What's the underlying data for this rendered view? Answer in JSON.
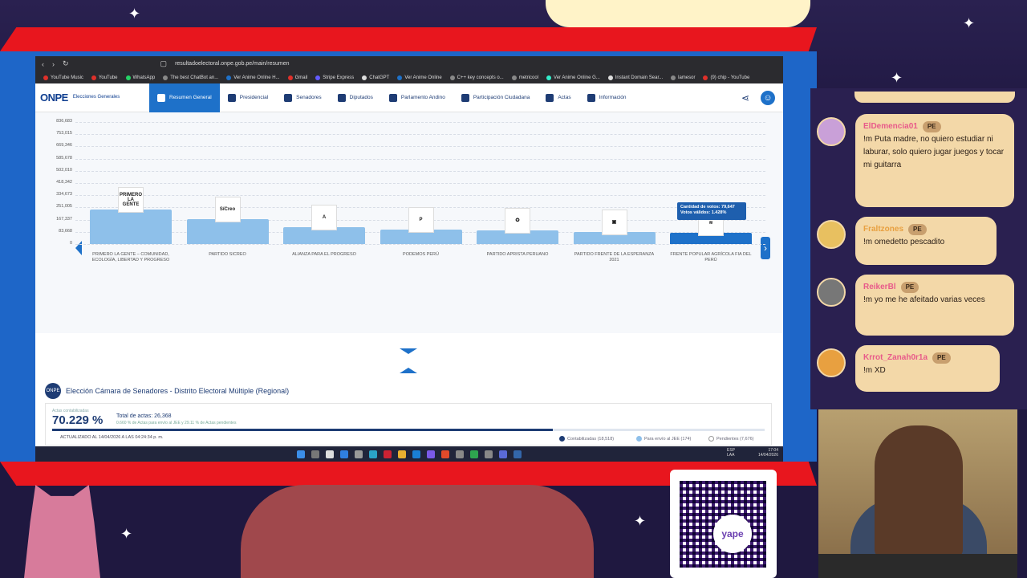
{
  "browser": {
    "url": "resultadoelectoral.onpe.gob.pe/main/resumen",
    "bookmarks": [
      {
        "label": "YouTube Music",
        "color": "#e0302a"
      },
      {
        "label": "YouTube",
        "color": "#e0302a"
      },
      {
        "label": "WhatsApp",
        "color": "#25d366"
      },
      {
        "label": "The best ChatBot an...",
        "color": "#888"
      },
      {
        "label": "Ver Anime Online H...",
        "color": "#1e71c9"
      },
      {
        "label": "Gmail",
        "color": "#e0302a"
      },
      {
        "label": "Stripe Express",
        "color": "#635bff"
      },
      {
        "label": "ChatGPT",
        "color": "#ddd"
      },
      {
        "label": "Ver Anime Online",
        "color": "#1e71c9"
      },
      {
        "label": "C++ key concepts o...",
        "color": "#888"
      },
      {
        "label": "metricool",
        "color": "#888"
      },
      {
        "label": "Ver Anime Online G...",
        "color": "#3ec"
      },
      {
        "label": "Instant Domain Sear...",
        "color": "#ddd"
      },
      {
        "label": "lamesor",
        "color": "#888"
      },
      {
        "label": "(9) chip - YouTube",
        "color": "#e0302a"
      }
    ]
  },
  "site": {
    "logo": "ONPE",
    "logo_sub": "Elecciones Generales",
    "nav": [
      {
        "label": "Resumen General",
        "active": true
      },
      {
        "label": "Presidencial"
      },
      {
        "label": "Senadores"
      },
      {
        "label": "Diputados"
      },
      {
        "label": "Parlamento Andino"
      },
      {
        "label": "Participación Ciudadana"
      },
      {
        "label": "Actas"
      },
      {
        "label": "Información"
      }
    ]
  },
  "chart_data": {
    "type": "bar",
    "yticks": [
      "836,683",
      "753,015",
      "669,346",
      "585,678",
      "502,010",
      "418,342",
      "334,673",
      "251,005",
      "167,337",
      "83,668",
      "0"
    ],
    "ylim": [
      0,
      836683
    ],
    "categories": [
      "PRIMERO LA GENTE – COMUNIDAD, ECOLOGÍA, LIBERTAD Y PROGRESO",
      "PARTIDO SICREO",
      "ALIANZA PARA EL PROGRESO",
      "PODEMOS PERÚ",
      "PARTIDO APRISTA PERUANO",
      "PARTIDO FRENTE DE LA ESPERANZA 2021",
      "FRENTE POPULAR AGRÍCOLA FIA DEL PERÚ"
    ],
    "logos": [
      "PRIMERO LA GENTE",
      "SíCreo",
      "A",
      "P",
      "✪",
      "▣",
      "≋"
    ],
    "values": [
      235000,
      172000,
      118000,
      98000,
      93000,
      84000,
      79647
    ],
    "selected_index": 6,
    "tooltip": {
      "line1": "Cantidad de votos: 79,647",
      "line2": "Votos válidos: 1.428%"
    }
  },
  "senate": {
    "title": "Elección Cámara de Senadores - Distrito Electoral Múltiple (Regional)",
    "pct_label": "Actas contabilizadas",
    "pct_value": "70.229 %",
    "total_actas": "Total de actas: 26,368",
    "sub_note": "0.660 % de Actas para envío al JEE y 29.11 % de Actas pendientes",
    "progress": 0.70229,
    "updated": "ACTUALIZADO AL 14/04/2026 A LAS 04:24:34 p. m.",
    "legend": [
      {
        "label": "Contabilizadas (18,518)",
        "color": "#1e3c74"
      },
      {
        "label": "Para envío al JEE (174)",
        "color": "#8ec0ea"
      },
      {
        "label": "Pendientes (7,676)",
        "color": "#ffffff"
      }
    ]
  },
  "taskbar": {
    "lang": "ESP\nLAA",
    "time": "17:04",
    "date": "14/04/2026"
  },
  "chat": [
    {
      "name": "ElDemencia01",
      "badge": "PE",
      "name_color": "#e85a8a",
      "text": "!m Puta madre, no quiero estudiar ni laburar, solo quiero jugar juegos y tocar mi guitarra"
    },
    {
      "name": "Fraltzones",
      "badge": "PE",
      "name_color": "#e8a040",
      "text": "!m omedetto pescadito"
    },
    {
      "name": "ReikerBl",
      "badge": "PE",
      "name_color": "#e85a8a",
      "text": "!m yo me he afeitado varias veces"
    },
    {
      "name": "Krrot_Zanah0r1a",
      "badge": "PE",
      "name_color": "#e85a8a",
      "text": "!m XD"
    }
  ],
  "qr": {
    "brand": "yape"
  }
}
